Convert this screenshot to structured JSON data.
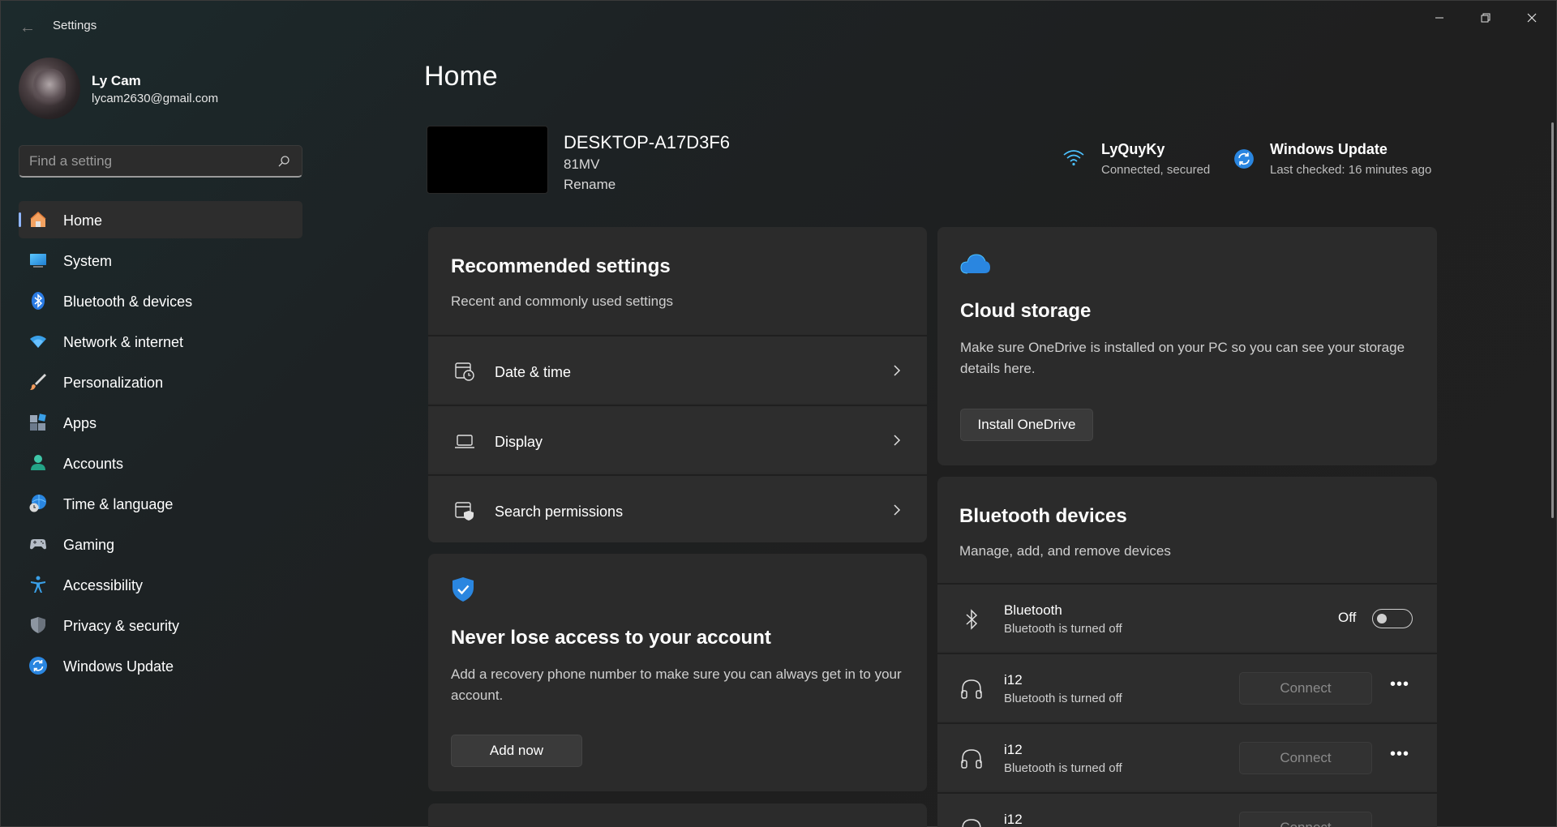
{
  "window": {
    "title": "Settings",
    "back_icon": "back-arrow-icon",
    "controls": [
      "minimize-icon",
      "restore-icon",
      "close-icon"
    ]
  },
  "profile": {
    "name": "Ly Cam",
    "email": "lycam2630@gmail.com"
  },
  "search": {
    "placeholder": "Find a setting",
    "value": ""
  },
  "sidebar": {
    "active": "Home",
    "items": [
      {
        "label": "Home",
        "icon": "home-icon"
      },
      {
        "label": "System",
        "icon": "system-icon"
      },
      {
        "label": "Bluetooth & devices",
        "icon": "bluetooth-icon"
      },
      {
        "label": "Network & internet",
        "icon": "network-icon"
      },
      {
        "label": "Personalization",
        "icon": "personalization-icon"
      },
      {
        "label": "Apps",
        "icon": "apps-icon"
      },
      {
        "label": "Accounts",
        "icon": "accounts-icon"
      },
      {
        "label": "Time & language",
        "icon": "time-language-icon"
      },
      {
        "label": "Gaming",
        "icon": "gaming-icon"
      },
      {
        "label": "Accessibility",
        "icon": "accessibility-icon"
      },
      {
        "label": "Privacy & security",
        "icon": "privacy-icon"
      },
      {
        "label": "Windows Update",
        "icon": "windows-update-icon"
      }
    ]
  },
  "main": {
    "title": "Home",
    "device": {
      "name": "DESKTOP-A17D3F6",
      "model": "81MV",
      "rename_label": "Rename"
    },
    "status": {
      "network_name": "LyQuyKy",
      "network_status": "Connected, secured",
      "update_title": "Windows Update",
      "update_status": "Last checked: 16 minutes ago"
    },
    "recommended": {
      "title": "Recommended settings",
      "subtitle": "Recent and commonly used settings",
      "items": [
        {
          "label": "Date & time",
          "icon": "date-time-icon"
        },
        {
          "label": "Display",
          "icon": "display-icon"
        },
        {
          "label": "Search permissions",
          "icon": "search-permissions-icon"
        }
      ]
    },
    "account_card": {
      "title": "Never lose access to your account",
      "body": "Add a recovery phone number to make sure you can always get in to your account.",
      "button": "Add now"
    },
    "cloud": {
      "title": "Cloud storage",
      "body": "Make sure OneDrive is installed on your PC so you can see your storage details here.",
      "button": "Install OneDrive"
    },
    "bluetooth": {
      "title": "Bluetooth devices",
      "subtitle": "Manage, add, and remove devices",
      "toggle_row": {
        "name": "Bluetooth",
        "status": "Bluetooth is turned off",
        "toggle_label": "Off",
        "on": false
      },
      "devices": [
        {
          "name": "i12",
          "status": "Bluetooth is turned off",
          "button": "Connect",
          "icon": "headphones-icon"
        },
        {
          "name": "i12",
          "status": "Bluetooth is turned off",
          "button": "Connect",
          "icon": "headphones-icon"
        },
        {
          "name": "i12",
          "status": "",
          "button": "Connect",
          "icon": "headphones-icon"
        }
      ]
    }
  },
  "colors": {
    "accent": "#4cc2ff",
    "background": "#202020",
    "card": "#2b2b2b"
  }
}
